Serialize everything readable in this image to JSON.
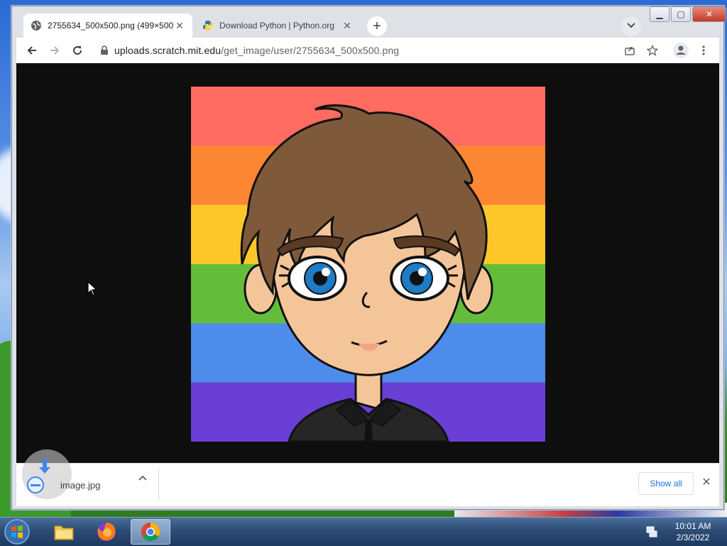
{
  "browser": {
    "tabs": [
      {
        "title": "2755634_500x500.png (499×500)",
        "active": true
      },
      {
        "title": "Download Python | Python.org",
        "active": false
      }
    ],
    "address": {
      "host": "uploads.scratch.mit.edu",
      "path": "/get_image/user/2755634_500x500.png"
    }
  },
  "downloads": {
    "file_name": "image.jpg",
    "show_all_label": "Show all"
  },
  "taskbar": {
    "time": "10:01 AM",
    "date": "2/3/2022"
  },
  "colors": {
    "rainbow": [
      "#fe6b61",
      "#fd8633",
      "#fdc72a",
      "#64bd3a",
      "#4e8cec",
      "#6a3fd6"
    ],
    "hair": "#7f5a3a",
    "skin": "#f5c59a",
    "eye": "#1e7bc4",
    "shirt": "#262626"
  }
}
